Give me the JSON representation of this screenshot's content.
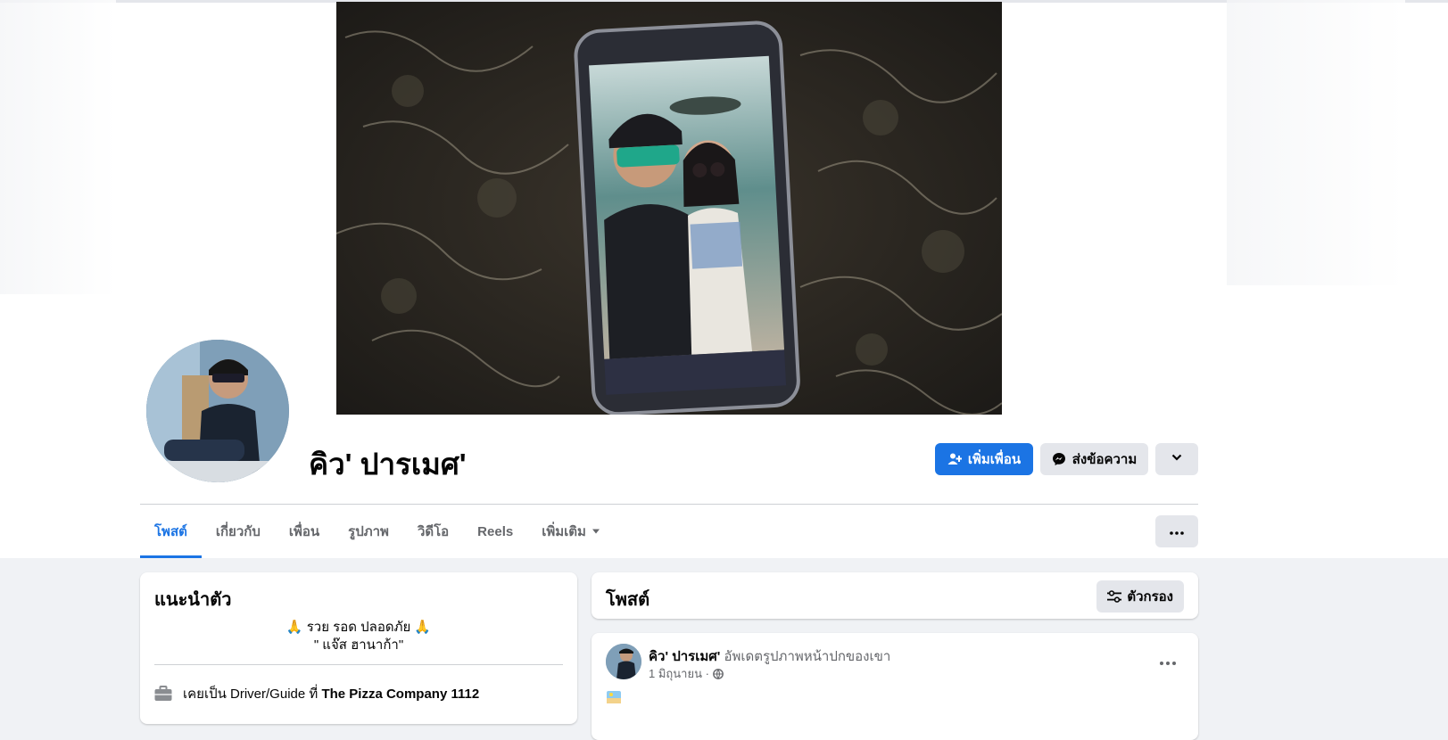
{
  "profile": {
    "name": "คิว' ปารเมศ'"
  },
  "actions": {
    "add_friend_label": "เพิ่มเพื่อน",
    "message_label": "ส่งข้อความ"
  },
  "tabs": [
    {
      "label": "โพสต์",
      "active": true
    },
    {
      "label": "เกี่ยวกับ",
      "active": false
    },
    {
      "label": "เพื่อน",
      "active": false
    },
    {
      "label": "รูปภาพ",
      "active": false
    },
    {
      "label": "วิดีโอ",
      "active": false
    },
    {
      "label": "Reels",
      "active": false
    },
    {
      "label": "เพิ่มเติม",
      "active": false
    }
  ],
  "intro": {
    "title": "แนะนำตัว",
    "bio_line1": "🙏 รวย รอด ปลอดภัย 🙏",
    "bio_line2": "\" แจ๊ส ฮานาก้า\"",
    "work_prefix": "เคยเป็น Driver/Guide ที่",
    "work_place": "The Pizza Company 1112"
  },
  "posts_header": {
    "title": "โพสต์",
    "filter_label": "ตัวกรอง"
  },
  "post": {
    "author": "คิว' ปารเมศ'",
    "action": "อัพเดตรูปภาพหน้าปกของเขา",
    "date": "1 มิถุนายน ·"
  },
  "colors": {
    "accent": "#1b74e4",
    "page_bg": "#f0f2f5",
    "secondary_button": "#e4e6eb"
  },
  "icons": {
    "add_friend": "person-plus-icon",
    "message": "messenger-icon",
    "dropdown": "chevron-down-icon",
    "more": "ellipsis-icon",
    "filter": "sliders-icon",
    "work": "briefcase-icon",
    "audience": "globe-icon"
  }
}
